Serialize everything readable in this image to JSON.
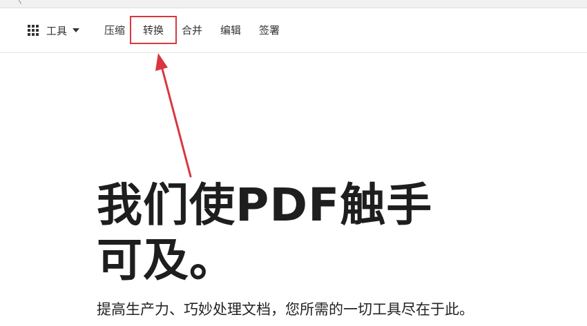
{
  "nav": {
    "tools_label": "工具",
    "items": {
      "compress": "压缩",
      "convert": "转换",
      "merge": "合并",
      "edit": "编辑",
      "sign": "签署"
    }
  },
  "hero": {
    "title": "我们使PDF触手可及。",
    "subtitle": "提高生产力、巧妙处理文档，您所需的一切工具尽在于此。"
  },
  "colors": {
    "annotation_red": "#d9363e",
    "text_dark": "#1e1e1e"
  }
}
